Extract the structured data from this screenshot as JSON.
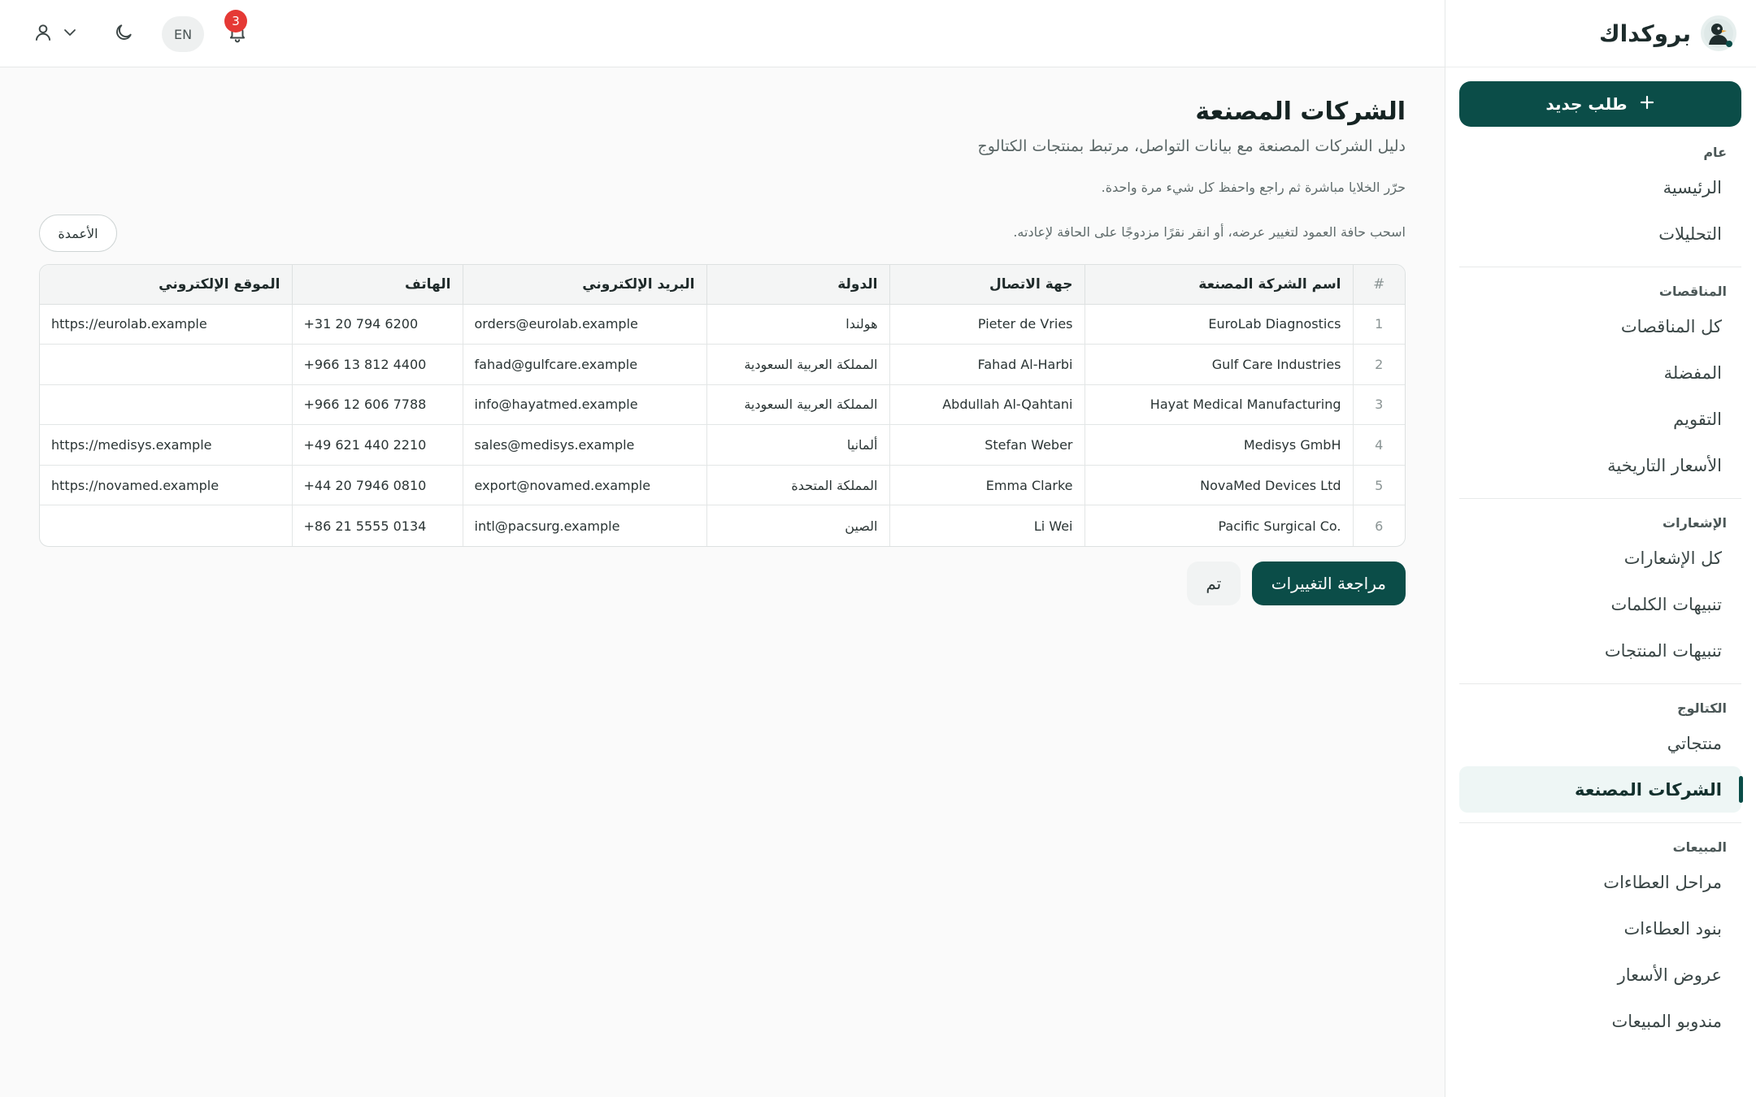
{
  "brand": {
    "name": "بروكداك"
  },
  "sidebar": {
    "new_request_label": "طلب جديد",
    "sections": [
      {
        "title": "عام",
        "items": [
          {
            "label": "الرئيسية"
          },
          {
            "label": "التحليلات"
          }
        ]
      },
      {
        "title": "المناقصات",
        "items": [
          {
            "label": "كل المناقصات"
          },
          {
            "label": "المفضلة"
          },
          {
            "label": "التقويم"
          },
          {
            "label": "الأسعار التاريخية"
          }
        ]
      },
      {
        "title": "الإشعارات",
        "items": [
          {
            "label": "كل الإشعارات"
          },
          {
            "label": "تنبيهات الكلمات"
          },
          {
            "label": "تنبيهات المنتجات"
          }
        ]
      },
      {
        "title": "الكتالوج",
        "items": [
          {
            "label": "منتجاتي"
          },
          {
            "label": "الشركات المصنعة",
            "active": true
          }
        ]
      },
      {
        "title": "المبيعات",
        "items": [
          {
            "label": "مراحل العطاءات"
          },
          {
            "label": "بنود العطاءات"
          },
          {
            "label": "عروض الأسعار"
          },
          {
            "label": "مندوبو المبيعات"
          }
        ]
      }
    ]
  },
  "topbar": {
    "notification_count": "3",
    "language_label": "EN",
    "icons": [
      "bell-icon",
      "moon-icon",
      "user-icon",
      "chevron-down-icon"
    ]
  },
  "page": {
    "title": "الشركات المصنعة",
    "subtitle": "دليل الشركات المصنعة مع بيانات التواصل، مرتبط بمنتجات الكتالوج",
    "hint_edit": "حرّر الخلايا مباشرة ثم راجع واحفظ كل شيء مرة واحدة.",
    "hint_resize": "اسحب حافة العمود لتغيير عرضه، أو انقر نقرًا مزدوجًا على الحافة لإعادته.",
    "columns_button": "الأعمدة",
    "review_button": "مراجعة التغييرات",
    "done_button": "تم"
  },
  "table": {
    "headers": {
      "index": "#",
      "name": "اسم الشركة المصنعة",
      "contact": "جهة الاتصال",
      "country": "الدولة",
      "email": "البريد الإلكتروني",
      "phone": "الهاتف",
      "website": "الموقع الإلكتروني"
    },
    "rows": [
      {
        "index": "1",
        "name": "EuroLab Diagnostics",
        "contact": "Pieter de Vries",
        "country": "هولندا",
        "email": "orders@eurolab.example",
        "phone": "+31 20 794 6200",
        "website": "https://eurolab.example"
      },
      {
        "index": "2",
        "name": "Gulf Care Industries",
        "contact": "Fahad Al-Harbi",
        "country": "المملكة العربية السعودية",
        "email": "fahad@gulfcare.example",
        "phone": "+966 13 812 4400",
        "website": ""
      },
      {
        "index": "3",
        "name": "Hayat Medical Manufacturing",
        "contact": "Abdullah Al-Qahtani",
        "country": "المملكة العربية السعودية",
        "email": "info@hayatmed.example",
        "phone": "+966 12 606 7788",
        "website": ""
      },
      {
        "index": "4",
        "name": "Medisys GmbH",
        "contact": "Stefan Weber",
        "country": "ألمانيا",
        "email": "sales@medisys.example",
        "phone": "+49 621 440 2210",
        "website": "https://medisys.example"
      },
      {
        "index": "5",
        "name": "NovaMed Devices Ltd",
        "contact": "Emma Clarke",
        "country": "المملكة المتحدة",
        "email": "export@novamed.example",
        "phone": "+44 20 7946 0810",
        "website": "https://novamed.example"
      },
      {
        "index": "6",
        "name": "Pacific Surgical Co.",
        "contact": "Li Wei",
        "country": "الصين",
        "email": "intl@pacsurg.example",
        "phone": "+86 21 5555 0134",
        "website": ""
      }
    ]
  },
  "colors": {
    "primary": "#0b4d48",
    "badge": "#e53935",
    "active_bg": "#eef6f5"
  }
}
